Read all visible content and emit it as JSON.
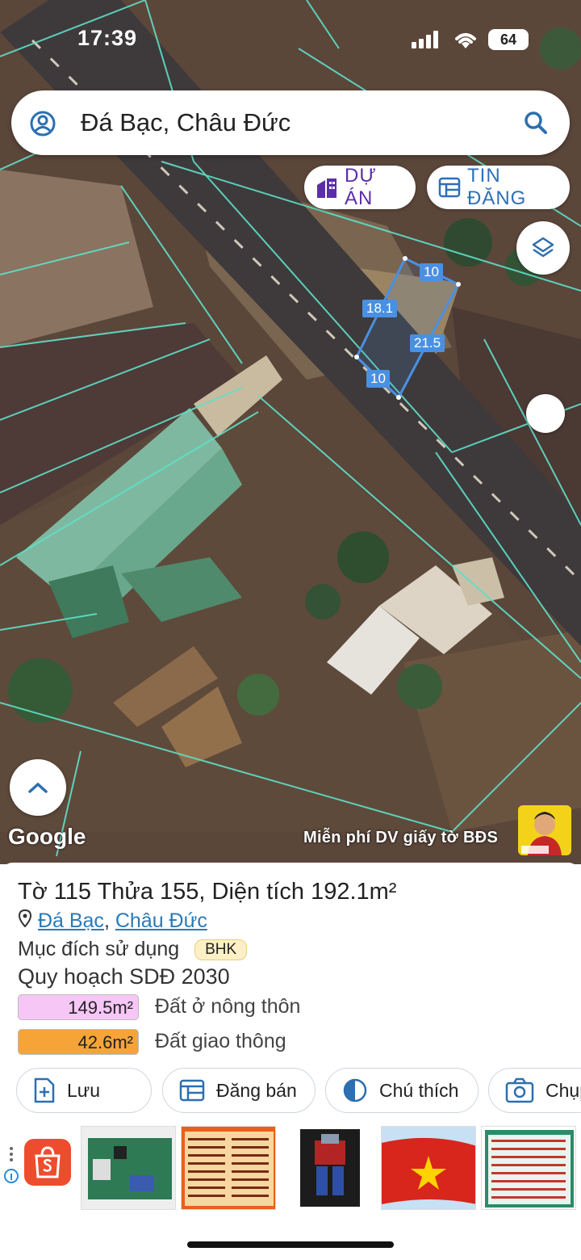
{
  "status": {
    "time": "17:39",
    "battery": "64"
  },
  "search": {
    "query": "Đá Bạc, Châu Đức"
  },
  "chips": {
    "du_an": "DỰ ÁN",
    "tin_dang": "TIN ĐĂNG"
  },
  "map": {
    "attribution": "Google",
    "promo": "Miễn phí DV giấy tờ BĐS",
    "dimensions": [
      "10",
      "18.1",
      "21.5",
      "10"
    ],
    "colors": {
      "parcel_line": "#5fe0c9",
      "selected_parcel": "#4a90e2"
    }
  },
  "parcel": {
    "to_label": "Tờ",
    "to_value": "115",
    "thua_label": "Thửa",
    "thua_value": "155",
    "area_label": "Diện tích",
    "area_value": "192.1m²",
    "location_1": "Đá Bạc",
    "location_2": "Châu Đức",
    "purpose_label": "Mục đích sử dụng",
    "purpose_code": "BHK",
    "plan_label": "Quy hoạch SDĐ 2030",
    "zones": [
      {
        "area": "149.5m²",
        "label": "Đất ở nông thôn",
        "color": "#f6c6f6"
      },
      {
        "area": "42.6m²",
        "label": "Đất giao thông",
        "color": "#f6a438"
      }
    ]
  },
  "actions": {
    "save": "Lưu",
    "post": "Đăng bán",
    "legend": "Chú thích",
    "capture": "Chụp"
  }
}
